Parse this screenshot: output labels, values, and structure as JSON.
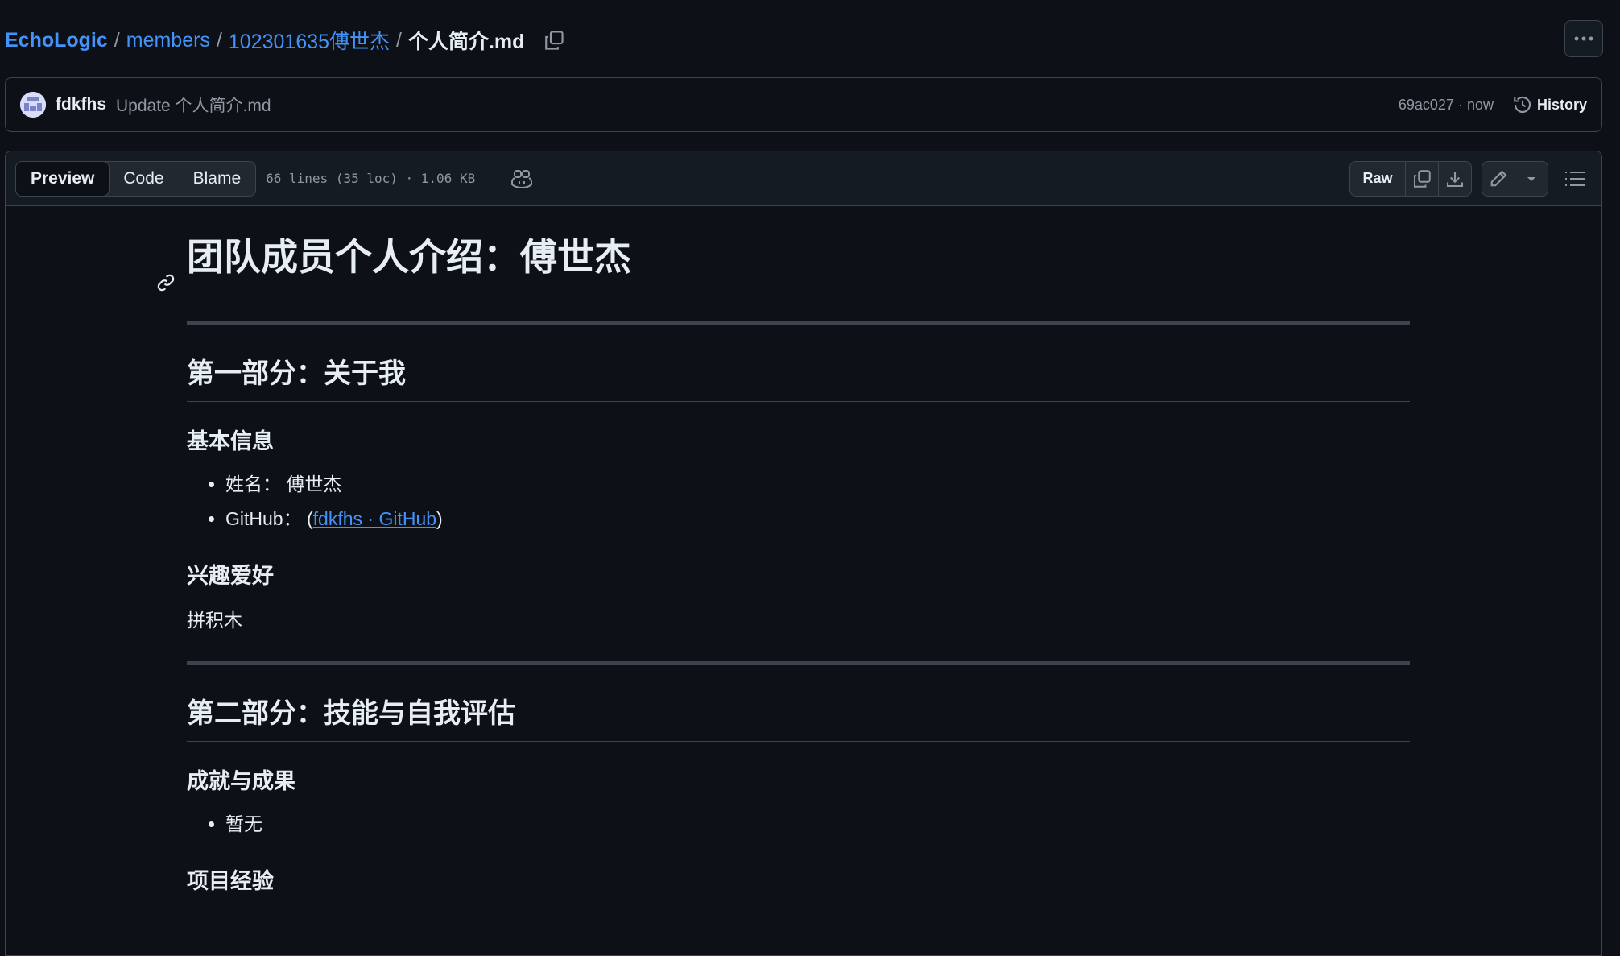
{
  "breadcrumb": {
    "repo": "EchoLogic",
    "sep": "/",
    "folder1": "members",
    "folder2": "102301635傅世杰",
    "file": "个人简介.md"
  },
  "commit": {
    "author": "fdkfhs",
    "message": "Update 个人简介.md",
    "sha_time": "69ac027 · now",
    "history_label": "History"
  },
  "file_header": {
    "tabs": [
      "Preview",
      "Code",
      "Blame"
    ],
    "active_tab": "Preview",
    "meta": "66 lines (35 loc) · 1.06 KB",
    "raw_label": "Raw"
  },
  "doc": {
    "title": "团队成员个人介绍：傅世杰",
    "section1": "第一部分：关于我",
    "basic_info": "基本信息",
    "name_item": "姓名： 傅世杰",
    "github_prefix": "GitHub： (",
    "github_link": "fdkfhs · GitHub",
    "github_suffix": ")",
    "hobbies": "兴趣爱好",
    "hobby_text": "拼积木",
    "section2": "第二部分：技能与自我评估",
    "achievements": "成就与成果",
    "achievement_item": "暂无",
    "projects": "项目经验"
  },
  "colors": {
    "background": "#0d1117",
    "link": "#4493f8",
    "border": "#3d444d",
    "text": "#e6edf3",
    "muted": "#9198a1"
  }
}
